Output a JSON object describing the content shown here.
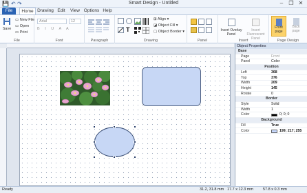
{
  "window": {
    "title": "Smart Design - Untitled",
    "controls": [
      "–",
      "❐",
      "✕"
    ]
  },
  "quick_access": [
    "💾",
    "↶",
    "↷"
  ],
  "tabs": [
    "File",
    "Home",
    "Drawing",
    "Edit",
    "View",
    "Options",
    "Help"
  ],
  "ribbon": {
    "file_group": {
      "label": "File",
      "save": "Save",
      "new_file": "New File",
      "open": "Open",
      "print": "Print"
    },
    "font_group": {
      "label": "Font",
      "font_name": "Arial",
      "font_size": "12"
    },
    "paragraph_group": {
      "label": "Paragraph"
    },
    "drawing_group": {
      "label": "Drawing",
      "align": "Align",
      "object_fill": "Object Fill",
      "object_border": "Object Border"
    },
    "panel_group": {
      "label": "Panel"
    },
    "insert_group": {
      "label": "Insert",
      "insert_overlay": "Insert Overlay Panel",
      "insert_fluorescent": "Insert Fluorescent Panel"
    },
    "page_design_group": {
      "label": "Page Design",
      "front_page": "Front page",
      "back_page": "Back page"
    }
  },
  "properties": {
    "title": "Object Properties",
    "rows": [
      {
        "type": "section",
        "key": "Base"
      },
      {
        "key": "Page",
        "value": "Front",
        "dim": true
      },
      {
        "key": "Panel",
        "value": "Color"
      },
      {
        "type": "section-center",
        "key": "Position"
      },
      {
        "key": "Left",
        "value": "368",
        "bold": true
      },
      {
        "key": "Top",
        "value": "376",
        "bold": true
      },
      {
        "key": "Width",
        "value": "209",
        "bold": true
      },
      {
        "key": "Height",
        "value": "145",
        "bold": true
      },
      {
        "key": "Rotate",
        "value": "0"
      },
      {
        "type": "section-center",
        "key": "Border"
      },
      {
        "key": "Style",
        "value": "Solid"
      },
      {
        "key": "Width",
        "value": "1"
      },
      {
        "key": "Color",
        "value": "0; 0; 0",
        "swatch": "#000000"
      },
      {
        "type": "section-center",
        "key": "Background"
      },
      {
        "key": "Fill",
        "value": "True",
        "bold": true
      },
      {
        "key": "Color",
        "value": "199; 217; 255",
        "swatch": "#c7d9ff",
        "bold": true
      }
    ]
  },
  "status": {
    "ready": "Ready",
    "cursor": "31.2, 31.8 mm",
    "size1": "17.7 x 12.3 mm",
    "size2": "57.8 x 0.3 mm"
  },
  "colors": {
    "accent": "#2b63b4",
    "shape_fill": "#c7d9ff",
    "shape_border": "#3b4c6e"
  }
}
